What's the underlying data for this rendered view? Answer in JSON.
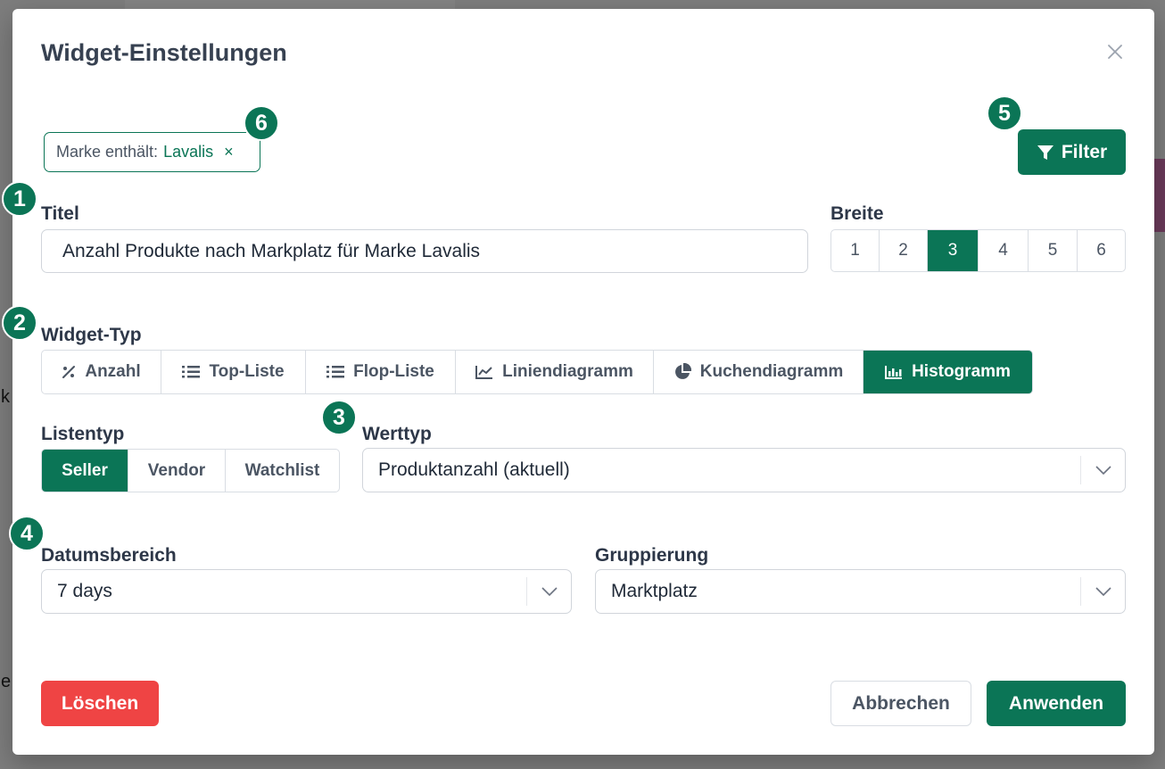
{
  "modal": {
    "title": "Widget-Einstellungen"
  },
  "filter_chip": {
    "label": "Marke enthält:",
    "value": "Lavalis",
    "remove": "×"
  },
  "filter_button": {
    "label": "Filter"
  },
  "annotations": [
    "1",
    "2",
    "3",
    "4",
    "5",
    "6"
  ],
  "title_field": {
    "label": "Titel",
    "value": "Anzahl Produkte nach Markplatz für Marke Lavalis"
  },
  "width": {
    "label": "Breite",
    "options": [
      "1",
      "2",
      "3",
      "4",
      "5",
      "6"
    ],
    "selected": "3"
  },
  "widget_type": {
    "label": "Widget-Typ",
    "options": [
      "Anzahl",
      "Top-Liste",
      "Flop-Liste",
      "Liniendiagramm",
      "Kuchendiagramm",
      "Histogramm"
    ],
    "selected": "Histogramm"
  },
  "list_type": {
    "label": "Listentyp",
    "options": [
      "Seller",
      "Vendor",
      "Watchlist"
    ],
    "selected": "Seller"
  },
  "value_type": {
    "label": "Werttyp",
    "value": "Produktanzahl (aktuell)"
  },
  "date_range": {
    "label": "Datumsbereich",
    "value": "7 days"
  },
  "grouping": {
    "label": "Gruppierung",
    "value": "Marktplatz"
  },
  "footer": {
    "delete": "Löschen",
    "cancel": "Abbrechen",
    "apply": "Anwenden"
  },
  "background": {
    "text_a": "k",
    "text_b": "e"
  },
  "colors": {
    "accent": "#0b7556",
    "danger": "#ef4444",
    "overlay": "#7d7d7d"
  }
}
